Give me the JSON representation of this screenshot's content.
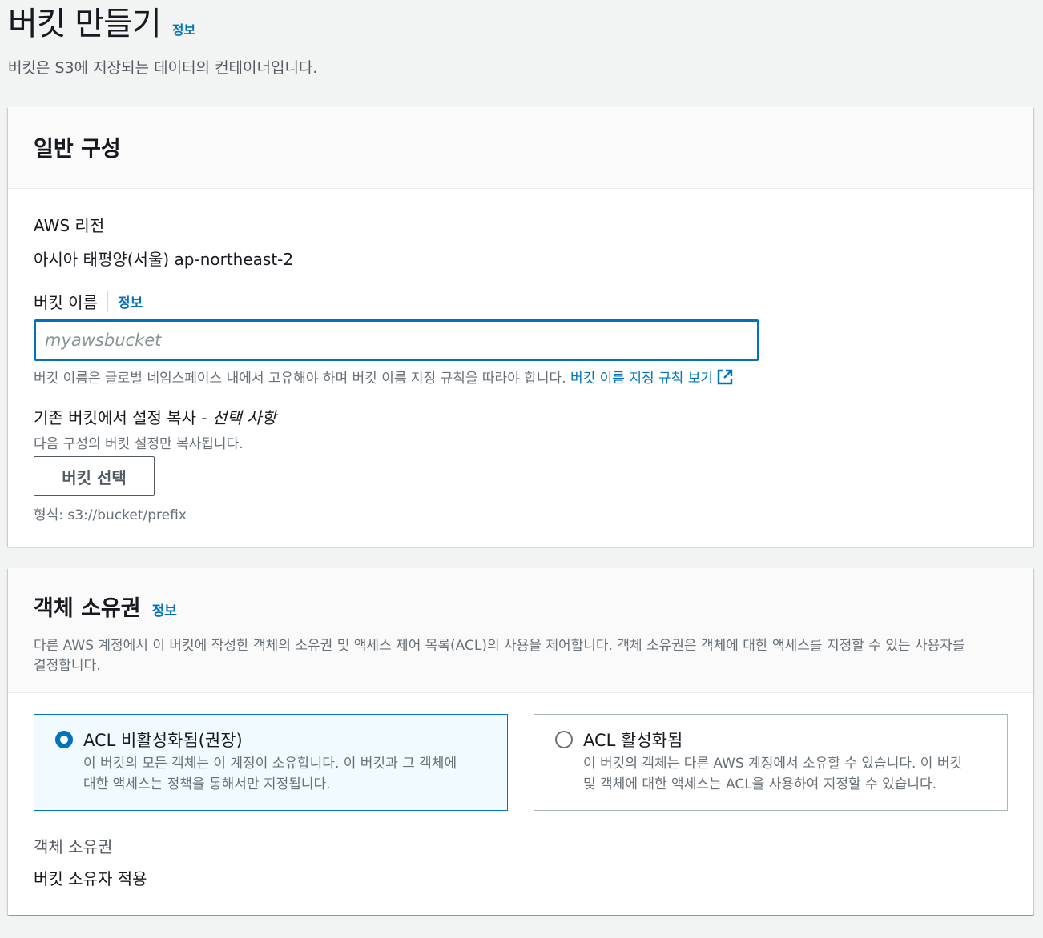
{
  "page": {
    "title": "버킷 만들기",
    "info": "정보",
    "description": "버킷은 S3에 저장되는 데이터의 컨테이너입니다."
  },
  "general": {
    "title": "일반 구성",
    "region_label": "AWS 리전",
    "region_value": "아시아 태평양(서울) ap-northeast-2",
    "bucket_name_label": "버킷 이름",
    "bucket_name_info": "정보",
    "bucket_name_placeholder": "myawsbucket",
    "bucket_name_hint": "버킷 이름은 글로벌 네임스페이스 내에서 고유해야 하며 버킷 이름 지정 규칙을 따라야 합니다.",
    "naming_rules_link": "버킷 이름 지정 규칙 보기",
    "copy_label": "기존 버킷에서 설정 복사 - ",
    "copy_optional": "선택 사항",
    "copy_desc": "다음 구성의 버킷 설정만 복사됩니다.",
    "select_button": "버킷 선택",
    "format_hint": "형식: s3://bucket/prefix"
  },
  "ownership": {
    "title": "객체 소유권",
    "info": "정보",
    "description_line1": "다른 AWS 계정에서 이 버킷에 작성한 객체의 소유권 및 액세스 제어 목록(ACL)의 사용을 제어합니다. 객체 소유권은 객체에 대한 액세스를 지정할 수 있는 사용자를",
    "description_line2": "결정합니다.",
    "options": [
      {
        "title": "ACL 비활성화됨(권장)",
        "desc_line1": "이 버킷의 모든 객체는 이 계정이 소유합니다. 이 버킷과 그 객체에",
        "desc_line2": "대한 액세스는 정책을 통해서만 지정됩니다.",
        "selected": true
      },
      {
        "title": "ACL 활성화됨",
        "desc_line1": "이 버킷의 객체는 다른 AWS 계정에서 소유할 수 있습니다. 이 버킷",
        "desc_line2": "및 객체에 대한 액세스는 ACL을 사용하여 지정할 수 있습니다.",
        "selected": false
      }
    ],
    "ownership_label": "객체 소유권",
    "ownership_value": "버킷 소유자 적용"
  },
  "colors": {
    "accent": "#0073bb",
    "page_bg": "#f2f3f3",
    "text": "#16191f",
    "muted": "#687078"
  }
}
